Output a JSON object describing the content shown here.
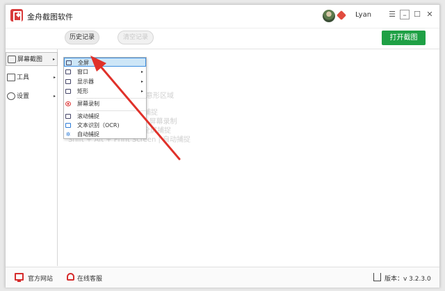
{
  "titlebar": {
    "app_title": "金舟截图软件",
    "username": "Lyan",
    "menu_glyph": "☰",
    "min_glyph": "–",
    "max_glyph": "☐",
    "close_glyph": "✕"
  },
  "toolbar": {
    "history_label": "历史记录",
    "disabled_label": "清空记录",
    "open_label": "打开截图"
  },
  "sidebar": {
    "items": [
      {
        "label": "屏幕截图",
        "icon": "screenshot-icon",
        "arrow": "▸"
      },
      {
        "label": "工具",
        "icon": "tools-icon",
        "arrow": "▸"
      },
      {
        "label": "设置",
        "icon": "settings-icon",
        "arrow": "▸"
      }
    ]
  },
  "main": {
    "hints": [
      "任意形区域",
      "捕捉",
      "| 屏幕录制",
      "全屏捕捉",
      "Shift + Alt + Print Screen  |  自动捕捉"
    ]
  },
  "dropdown": {
    "items": [
      {
        "label": "全屏",
        "icon": "fullscreen-icon",
        "sub": ""
      },
      {
        "label": "窗口",
        "icon": "window-icon",
        "sub": "▸"
      },
      {
        "label": "显示器",
        "icon": "monitor-icon",
        "sub": "▸"
      },
      {
        "label": "矩形",
        "icon": "rectangle-icon",
        "sub": "▸"
      },
      {
        "label": "屏幕录制",
        "icon": "record-icon",
        "sub": ""
      },
      {
        "label": "滚动捕捉",
        "icon": "scroll-capture-icon",
        "sub": ""
      },
      {
        "label": "文本识别（OCR)",
        "icon": "ocr-icon",
        "sub": ""
      },
      {
        "label": "自动捕捉",
        "icon": "auto-capture-icon",
        "sub": ""
      }
    ]
  },
  "statusbar": {
    "site_label": "官方网站",
    "service_label": "在线客服",
    "version_label": "版本：v 3.2.3.0"
  },
  "colors": {
    "brand_red": "#d93b3b",
    "accent_green": "#1fa045",
    "menu_highlight": "#cde6f7",
    "annotation_arrow": "#e0312a"
  }
}
